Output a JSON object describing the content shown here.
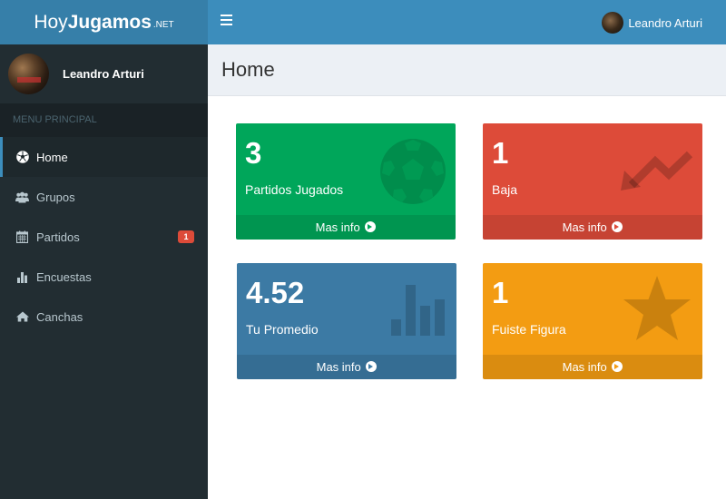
{
  "brand": {
    "part1": "Hoy",
    "part2": "Jugamos",
    "part3": ".NET"
  },
  "topbar": {
    "user_name": "Leandro Arturi"
  },
  "sidebar": {
    "user_name": "Leandro Arturi",
    "menu_header": "MENU PRINCIPAL",
    "items": [
      {
        "label": "Home",
        "icon": "soccer-ball-icon",
        "active": true
      },
      {
        "label": "Grupos",
        "icon": "users-icon"
      },
      {
        "label": "Partidos",
        "icon": "calendar-icon",
        "badge": "1"
      },
      {
        "label": "Encuestas",
        "icon": "bar-chart-icon"
      },
      {
        "label": "Canchas",
        "icon": "home-icon"
      }
    ]
  },
  "page": {
    "title": "Home"
  },
  "boxes": [
    {
      "value": "3",
      "label": "Partidos Jugados",
      "footer": "Mas info",
      "icon": "soccer-ball-icon",
      "color": "#00a65a"
    },
    {
      "value": "1",
      "label": "Baja",
      "footer": "Mas info",
      "icon": "trend-down-icon",
      "color": "#dd4b39"
    },
    {
      "value": "4.52",
      "label": "Tu Promedio",
      "footer": "Mas info",
      "icon": "bar-chart-icon",
      "color": "#3c7aa4"
    },
    {
      "value": "1",
      "label": "Fuiste Figura",
      "footer": "Mas info",
      "icon": "star-icon",
      "color": "#f39c12"
    }
  ],
  "colors": {
    "header": "#3c8dbc",
    "logo": "#367fa9",
    "sidebar": "#222d32",
    "badge": "#dd4b39"
  }
}
